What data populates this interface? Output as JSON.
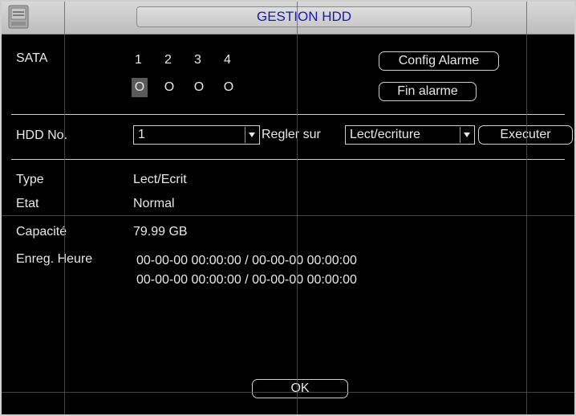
{
  "window": {
    "title": "GESTION HDD"
  },
  "sata": {
    "label": "SATA",
    "ports": [
      "1",
      "2",
      "3",
      "4"
    ],
    "indicators": [
      "O",
      "O",
      "O",
      "O"
    ],
    "selected_index": 0
  },
  "buttons": {
    "config_alarm": "Config Alarme",
    "end_alarm": "Fin alarme",
    "execute": "Executer",
    "ok": "OK"
  },
  "hdd": {
    "label": "HDD No.",
    "value": "1",
    "set_to_label": "Regler sur",
    "mode_value": "Lect/ecriture"
  },
  "info": {
    "type_label": "Type",
    "type_value": "Lect/Ecrit",
    "state_label": "Etat",
    "state_value": "Normal",
    "capacity_label": "Capacité",
    "capacity_value": "79.99 GB",
    "record_label": "Enreg. Heure",
    "record_line1": "00-00-00 00:00:00 / 00-00-00 00:00:00",
    "record_line2": "00-00-00 00:00:00 / 00-00-00 00:00:00"
  }
}
